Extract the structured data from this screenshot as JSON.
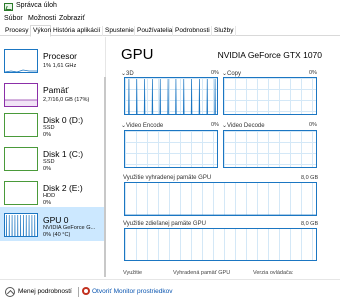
{
  "window": {
    "title": "Správca úloh"
  },
  "menu": [
    "Súbor",
    "Možnosti",
    "Zobraziť"
  ],
  "tabs": [
    {
      "label": "Procesy",
      "active": false
    },
    {
      "label": "Výkon",
      "active": true
    },
    {
      "label": "História aplikácií",
      "active": false
    },
    {
      "label": "Spustenie",
      "active": false
    },
    {
      "label": "Používatelia",
      "active": false
    },
    {
      "label": "Podrobnosti",
      "active": false
    },
    {
      "label": "Služby",
      "active": false
    }
  ],
  "sidebar": [
    {
      "name": "Procesor",
      "lines": [
        "1% 1,61 GHz"
      ],
      "color": "#1b76c2",
      "level": 0.05
    },
    {
      "name": "Pamäť",
      "lines": [
        "2,7/16,0 GB (17%)"
      ],
      "color": "#8b2fa8",
      "level": 0.17
    },
    {
      "name": "Disk 0 (D:)",
      "lines": [
        "SSD",
        "0%"
      ],
      "color": "#4a9a3a",
      "level": 0
    },
    {
      "name": "Disk 1 (C:)",
      "lines": [
        "SSD",
        "0%"
      ],
      "color": "#4a9a3a",
      "level": 0
    },
    {
      "name": "Disk 2 (E:)",
      "lines": [
        "HDD",
        "0%"
      ],
      "color": "#4a9a3a",
      "level": 0
    },
    {
      "name": "GPU 0",
      "lines": [
        "NVIDIA GeForce G...",
        "0% (40 °C)"
      ],
      "color": "#1b76c2",
      "active": true
    }
  ],
  "main": {
    "title": "GPU",
    "model": "NVIDIA GeForce GTX 1070",
    "engines": [
      {
        "label": "3D",
        "pct": "0%"
      },
      {
        "label": "Copy",
        "pct": "0%"
      },
      {
        "label": "Video Encode",
        "pct": "0%"
      },
      {
        "label": "Video Decode",
        "pct": "0%"
      }
    ],
    "dedicated_label": "Využitie vyhradenej pamäte GPU",
    "dedicated_max": "8,0 GB",
    "shared_label": "Využitie zdieľanej pamäte GPU",
    "shared_max": "8,0 GB",
    "stats": [
      "Využitie",
      "Vyhradená pamäť GPU",
      "Verzia ovládača:"
    ]
  },
  "footer": {
    "less_details": "Menej podrobností",
    "resource_monitor": "Otvoriť Monitor prostriedkov"
  },
  "colors": {
    "accent": "#1b76c2",
    "memory": "#8b2fa8",
    "disk": "#4a9a3a",
    "selected_bg": "#cce8ff",
    "link": "#0a55b0"
  }
}
